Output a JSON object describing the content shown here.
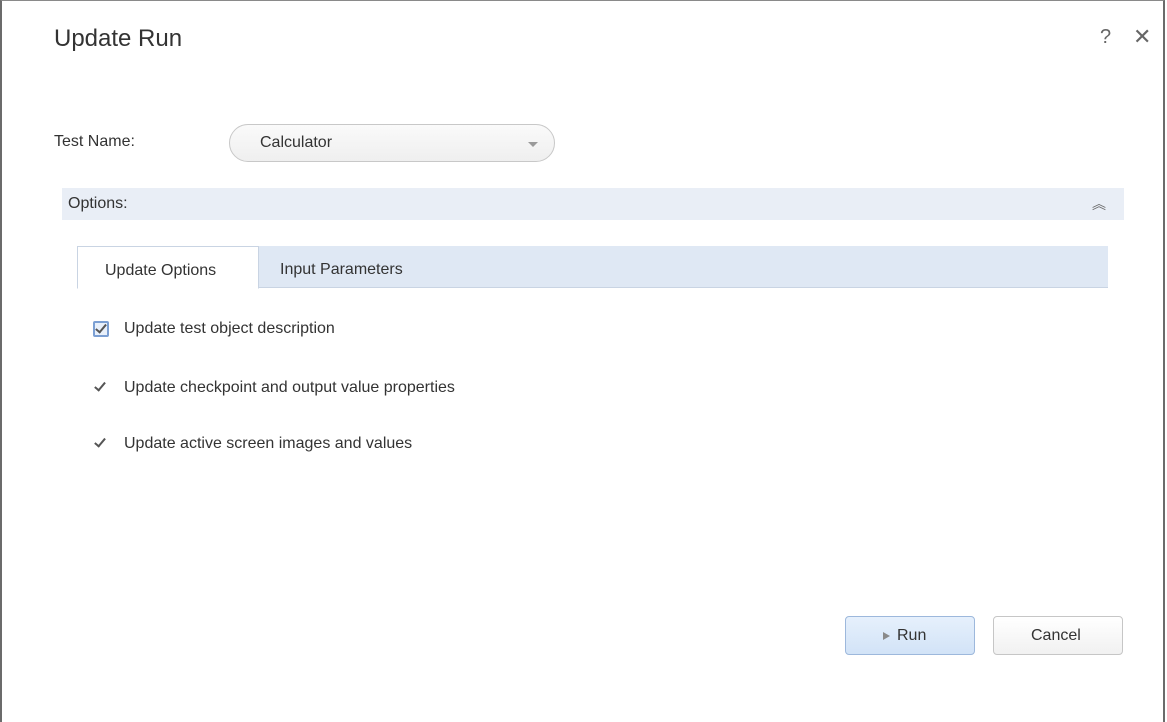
{
  "window": {
    "title": "Update Run",
    "help_label": "?",
    "close_label": "✕"
  },
  "test_name": {
    "label": "Test Name:",
    "selected": "Calculator"
  },
  "options": {
    "label": "Options:",
    "collapse_glyph": "︽"
  },
  "tabs": [
    {
      "label": "Update Options",
      "active": true
    },
    {
      "label": "Input Parameters",
      "active": false
    }
  ],
  "update_options": [
    {
      "label": "Update test object description",
      "checked": true
    },
    {
      "label": "Update checkpoint and output value properties",
      "checked": true
    },
    {
      "label": "Update active screen images and values",
      "checked": true
    }
  ],
  "buttons": {
    "run_label": "Run",
    "cancel_label": "Cancel"
  }
}
